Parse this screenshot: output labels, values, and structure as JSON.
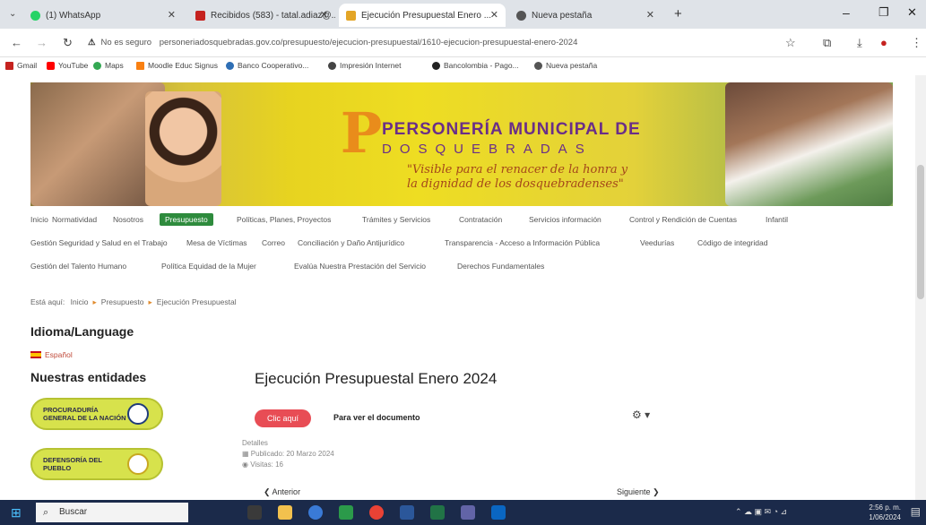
{
  "browser": {
    "tabs": [
      {
        "label": "(1) WhatsApp",
        "color": "#25d366"
      },
      {
        "label": "Recibidos (583) - tatal.adiaz@...",
        "color": "#c5221f"
      },
      {
        "label": "Ejecución Presupuestal Enero ...",
        "color": "#e3a526"
      },
      {
        "label": "Nueva pestaña",
        "color": "#555555"
      }
    ],
    "new_tab": "+",
    "url_warning": "No es seguro",
    "url": "personeriadosquebradas.gov.co/presupuesto/ejecucion-presupuestal/1610-ejecucion-presupuestal-enero-2024",
    "bookmarks": [
      "Gmail",
      "YouTube",
      "Maps",
      "Moodle Educ Signus",
      "Banco Cooperativo...",
      "Impresión Internet",
      "Bancolombia - Pago...",
      "Nueva pestaña"
    ]
  },
  "banner": {
    "org_line1": "PERSONERÍA MUNICIPAL DE",
    "org_line2": "DOSQUEBRADAS",
    "slogan_line1": "\"Visible para el renacer de la honra y",
    "slogan_line2": "la dignidad de los dosquebradenses\"",
    "logo_letter": "P"
  },
  "menu": {
    "row1": [
      "Inicio",
      "Normatividad",
      "Nosotros",
      "Presupuesto",
      "Políticas, Planes, Proyectos",
      "Trámites y Servicios",
      "Contratación",
      "Servicios información",
      "Control y Rendición de Cuentas",
      "Infantil"
    ],
    "row2": [
      "Gestión Seguridad y Salud en el Trabajo",
      "Mesa de Víctimas",
      "Correo",
      "Conciliación y Daño Antijurídico",
      "Transparencia - Acceso a Información Pública",
      "Veedurías",
      "Código de integridad"
    ],
    "row3": [
      "Gestión del Talento Humano",
      "Política Equidad de la Mujer",
      "Evalúa Nuestra Prestación del Servicio",
      "Derechos Fundamentales"
    ],
    "active": "Presupuesto"
  },
  "breadcrumb": {
    "prefix": "Está aquí:",
    "items": [
      "Inicio",
      "Presupuesto",
      "Ejecución Presupuestal"
    ]
  },
  "sidebar": {
    "language_heading": "Idioma/Language",
    "language_value": "Español",
    "entities_heading": "Nuestras entidades",
    "entities": [
      "PROCURADURÍA GENERAL DE LA NACIÓN",
      "DEFENSORÍA DEL PUEBLO"
    ]
  },
  "article": {
    "title": "Ejecución Presupuestal Enero 2024",
    "doc_button": "Clic aquí",
    "doc_text": "Para ver el documento",
    "details_label": "Detalles",
    "details_date": "Publicado: 20 Marzo 2024",
    "details_hits": "Visitas: 16",
    "prev": "Anterior",
    "next": "Siguiente"
  },
  "taskbar": {
    "search_label": "Buscar",
    "time": "2:56 p. m.",
    "date": "1/06/2024"
  }
}
